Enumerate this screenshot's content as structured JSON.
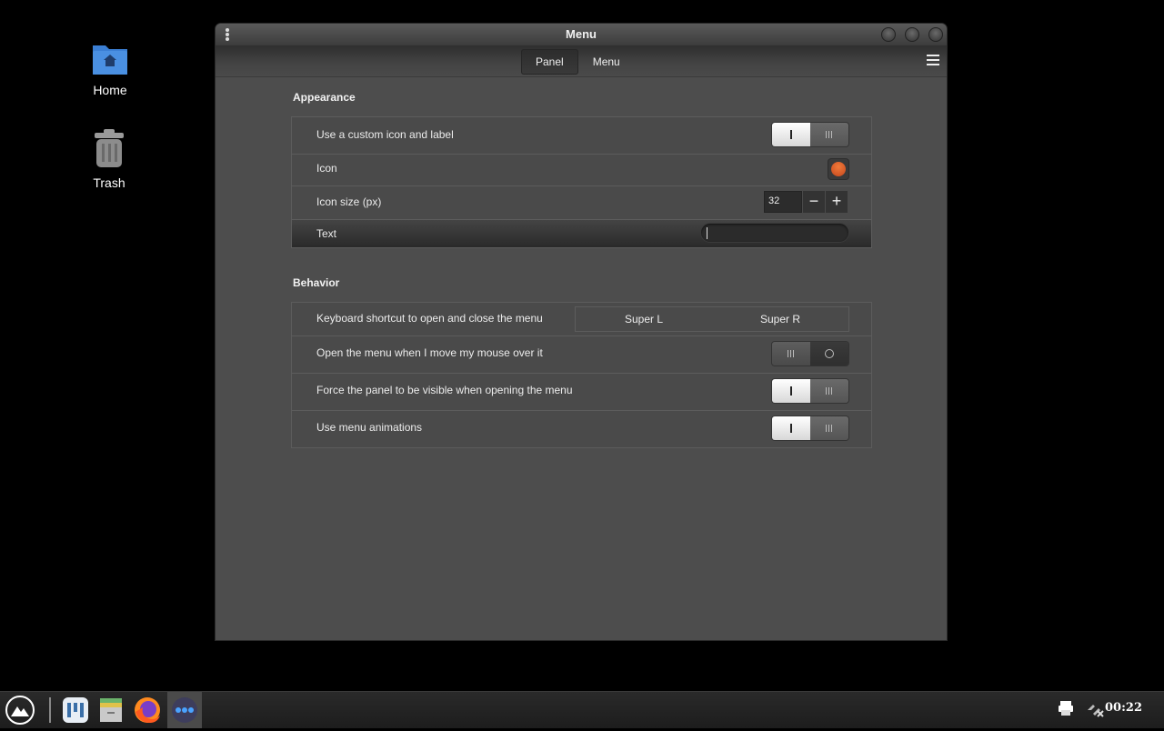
{
  "desktop": {
    "icons": [
      {
        "label": "Home",
        "icon": "home-folder-icon"
      },
      {
        "label": "Trash",
        "icon": "trash-icon"
      }
    ]
  },
  "window": {
    "title": "Menu",
    "tabs": [
      {
        "label": "Panel",
        "active": true
      },
      {
        "label": "Menu",
        "active": false
      }
    ]
  },
  "appearance": {
    "title": "Appearance",
    "custom_icon_label": "Use a custom icon and label",
    "custom_icon_enabled": true,
    "icon_label": "Icon",
    "icon_size_label": "Icon size (px)",
    "icon_size_value": "32",
    "text_label": "Text",
    "text_value": ""
  },
  "behavior": {
    "title": "Behavior",
    "shortcut_label": "Keyboard shortcut to open and close the menu",
    "shortcut_primary": "Super L",
    "shortcut_secondary": "Super R",
    "hover_label": "Open the menu when I move my mouse over it",
    "hover_enabled": false,
    "force_visible_label": "Force the panel to be visible when opening the menu",
    "force_visible_enabled": true,
    "animations_label": "Use menu animations",
    "animations_enabled": true
  },
  "taskbar": {
    "clock": "00:22",
    "items": [
      "menu-logo-icon",
      "apps-grid-icon",
      "files-icon",
      "firefox-icon",
      "more-apps-icon"
    ]
  },
  "colors": {
    "accent_icon": "#e0602a",
    "window_bg": "#4d4d4d"
  }
}
